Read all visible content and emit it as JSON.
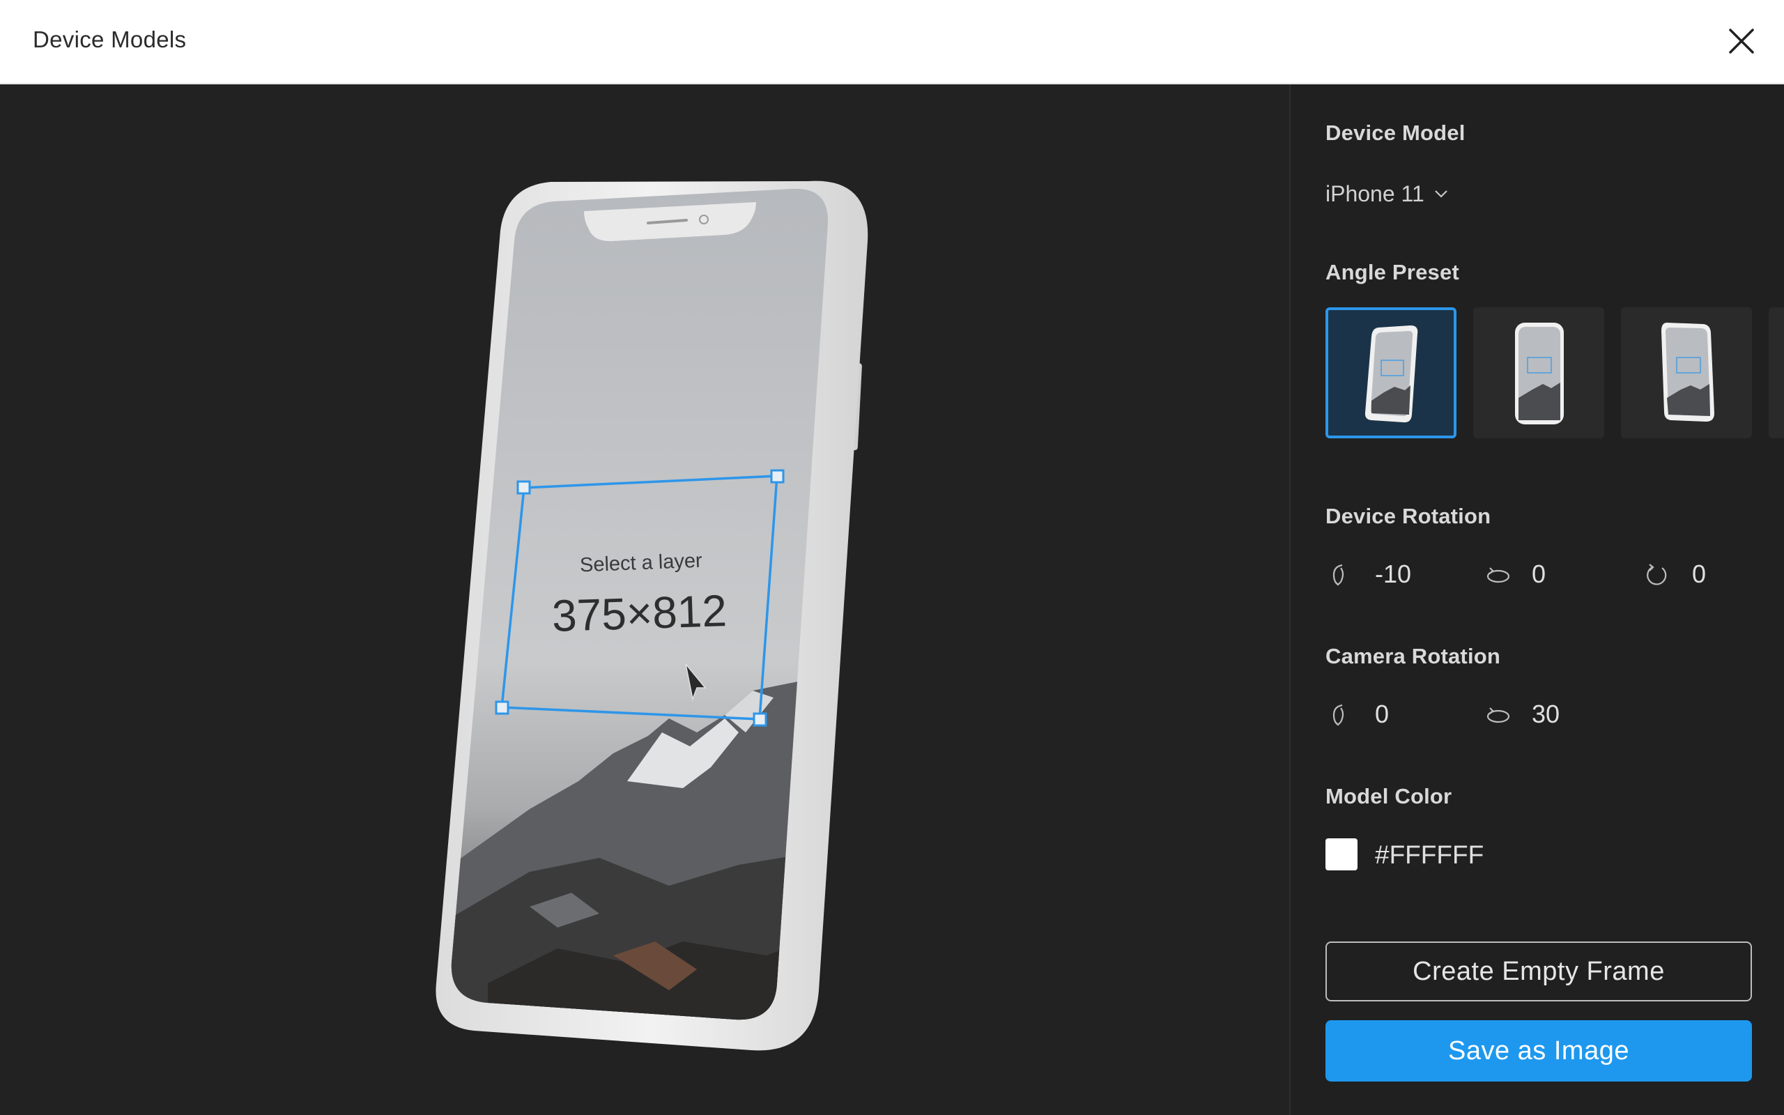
{
  "window": {
    "title": "Device Models"
  },
  "preview": {
    "hint": "Select a layer",
    "dimensions": "375×812"
  },
  "panel": {
    "device_model": {
      "label": "Device Model",
      "selected": "iPhone 11"
    },
    "angle_preset": {
      "label": "Angle Preset",
      "selected_index": 0,
      "count_visible": 3
    },
    "device_rotation": {
      "label": "Device Rotation",
      "x": "-10",
      "y": "0",
      "z": "0"
    },
    "camera_rotation": {
      "label": "Camera Rotation",
      "x": "0",
      "y": "30"
    },
    "model_color": {
      "label": "Model Color",
      "hex": "#FFFFFF"
    },
    "buttons": {
      "create_empty_frame": "Create Empty Frame",
      "save_as_image": "Save as Image"
    }
  },
  "colors": {
    "accent": "#1e98ee",
    "canvas_bg": "#222222",
    "panel_bg": "#202020",
    "selection": "#2d96ea"
  }
}
